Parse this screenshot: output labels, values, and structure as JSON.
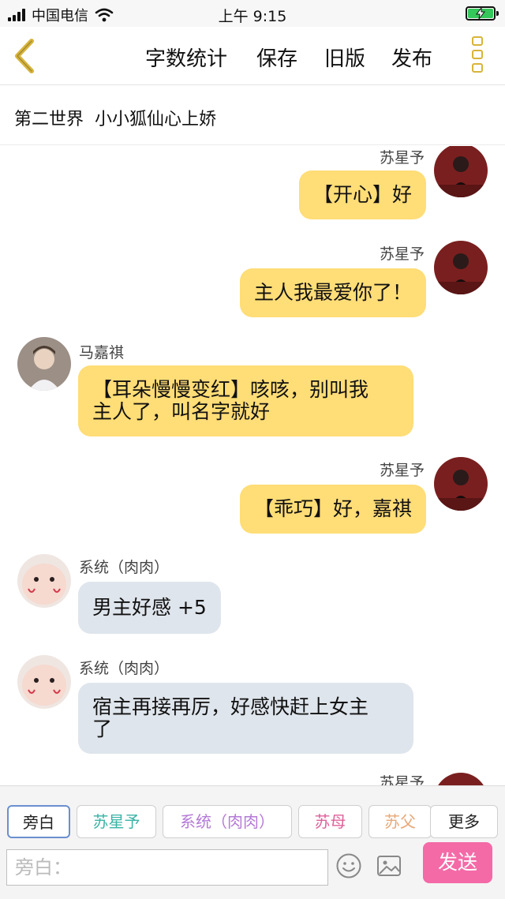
{
  "status_bar": {
    "carrier": "中国电信",
    "time": "上午 9:15"
  },
  "toolbar": {
    "word_count": "字数统计",
    "save": "保存",
    "old_version": "旧版",
    "publish": "发布"
  },
  "chapter": {
    "title": "第二世界  小小狐仙心上娇"
  },
  "messages": [
    {
      "name": "苏星予",
      "text": "【开心】好"
    },
    {
      "name": "苏星予",
      "text": "主人我最爱你了！"
    },
    {
      "name": "马嘉祺",
      "line1": "【耳朵慢慢变红】咳咳，别叫我",
      "line2": "主人了，叫名字就好"
    },
    {
      "name": "苏星予",
      "text": "【乖巧】好，嘉祺"
    },
    {
      "name": "系统（肉肉）",
      "text": "男主好感 +5"
    },
    {
      "name": "系统（肉肉）",
      "line1": "宿主再接再厉，好感快赶上女主",
      "line2": "了"
    },
    {
      "name": "苏星予"
    }
  ],
  "roles": [
    {
      "label": "旁白",
      "color": "#222222"
    },
    {
      "label": "苏星予",
      "color": "#3bb3a6"
    },
    {
      "label": "系统（肉肉）",
      "color": "#b57ad6"
    },
    {
      "label": "苏母",
      "color": "#e0609a"
    },
    {
      "label": "苏父",
      "color": "#e8a878"
    },
    {
      "label": "更多",
      "color": "#222222"
    }
  ],
  "composer": {
    "placeholder": "旁白：",
    "send": "发送"
  },
  "colors": {
    "accent": "#f46aa7",
    "self_bubble": "#ffdd77",
    "other_bubble": "#dfe5ec",
    "back_arrow": "#d7b43a"
  }
}
